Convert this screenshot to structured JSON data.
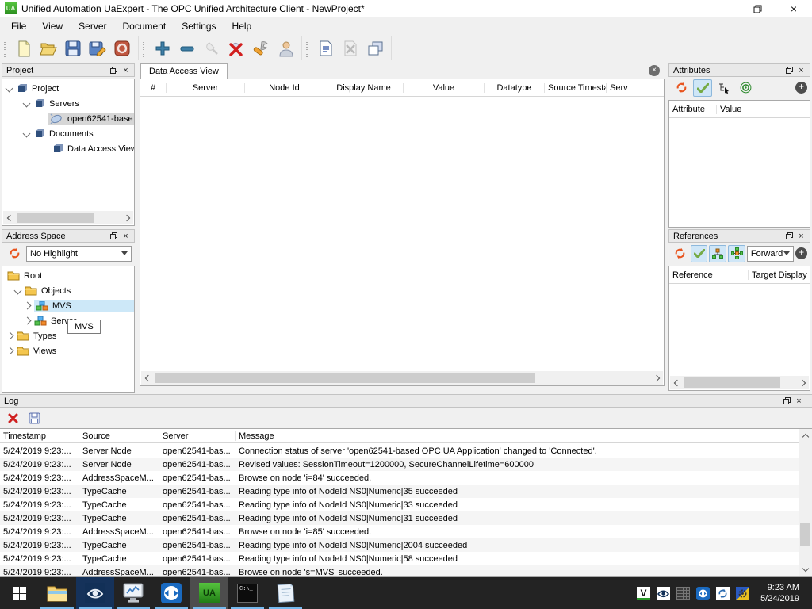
{
  "window": {
    "title": "Unified Automation UaExpert - The OPC Unified Architecture Client - NewProject*",
    "app_badge": "UA",
    "controls": {
      "minimize": "–",
      "close": "×"
    }
  },
  "menu": {
    "items": [
      "File",
      "View",
      "Server",
      "Document",
      "Settings",
      "Help"
    ]
  },
  "project": {
    "title": "Project",
    "tree": [
      {
        "label": "Project"
      },
      {
        "label": "Servers"
      },
      {
        "label": "open62541-base"
      },
      {
        "label": "Documents"
      },
      {
        "label": "Data Access View"
      }
    ]
  },
  "address_space": {
    "title": "Address Space",
    "highlight_dropdown": "No Highlight",
    "tooltip": "MVS",
    "tree": [
      {
        "label": "Root"
      },
      {
        "label": "Objects"
      },
      {
        "label": "MVS"
      },
      {
        "label": "Server"
      },
      {
        "label": "Types"
      },
      {
        "label": "Views"
      }
    ]
  },
  "dav": {
    "tab_label": "Data Access View",
    "columns": [
      "#",
      "Server",
      "Node Id",
      "Display Name",
      "Value",
      "Datatype",
      "Source Timestamp",
      "Serv"
    ]
  },
  "attributes": {
    "title": "Attributes",
    "columns": [
      "Attribute",
      "Value"
    ]
  },
  "references": {
    "title": "References",
    "direction": "Forward",
    "columns": [
      "Reference",
      "Target Display"
    ]
  },
  "log": {
    "title": "Log",
    "columns": [
      "Timestamp",
      "Source",
      "Server",
      "Message"
    ],
    "rows": [
      {
        "timestamp": "5/24/2019 9:23:...",
        "source": "Server Node",
        "server": "open62541-bas...",
        "message": "Connection status of server 'open62541-based OPC UA Application' changed to 'Connected'."
      },
      {
        "timestamp": "5/24/2019 9:23:...",
        "source": "Server Node",
        "server": "open62541-bas...",
        "message": "Revised values: SessionTimeout=1200000, SecureChannelLifetime=600000"
      },
      {
        "timestamp": "5/24/2019 9:23:...",
        "source": "AddressSpaceM...",
        "server": "open62541-bas...",
        "message": "Browse on node 'i=84' succeeded."
      },
      {
        "timestamp": "5/24/2019 9:23:...",
        "source": "TypeCache",
        "server": "open62541-bas...",
        "message": "Reading type info of NodeId NS0|Numeric|35 succeeded"
      },
      {
        "timestamp": "5/24/2019 9:23:...",
        "source": "TypeCache",
        "server": "open62541-bas...",
        "message": "Reading type info of NodeId NS0|Numeric|33 succeeded"
      },
      {
        "timestamp": "5/24/2019 9:23:...",
        "source": "TypeCache",
        "server": "open62541-bas...",
        "message": "Reading type info of NodeId NS0|Numeric|31 succeeded"
      },
      {
        "timestamp": "5/24/2019 9:23:...",
        "source": "AddressSpaceM...",
        "server": "open62541-bas...",
        "message": "Browse on node 'i=85' succeeded."
      },
      {
        "timestamp": "5/24/2019 9:23:...",
        "source": "TypeCache",
        "server": "open62541-bas...",
        "message": "Reading type info of NodeId NS0|Numeric|2004 succeeded"
      },
      {
        "timestamp": "5/24/2019 9:23:...",
        "source": "TypeCache",
        "server": "open62541-bas...",
        "message": "Reading type info of NodeId NS0|Numeric|58 succeeded"
      },
      {
        "timestamp": "5/24/2019 9:23:...",
        "source": "AddressSpaceM...",
        "server": "open62541-bas...",
        "message": "Browse on node 's=MVS' succeeded."
      }
    ]
  },
  "taskbar": {
    "clock": {
      "time": "9:23 AM",
      "date": "5/24/2019"
    },
    "uaexpert_badge": "UA",
    "cmd_badge": "C:\\_",
    "vcxsrv_badge": "V"
  },
  "colors": {
    "taskbar_bg": "#232323",
    "running_indicator": "#76b9ed",
    "selection_blue": "#cde8f8",
    "selection_gray": "#d6d6d6",
    "uaexpert_green": "#3aa32c",
    "refresh_orange": "#e8541e",
    "log_alt_row": "#f5f5f5"
  }
}
